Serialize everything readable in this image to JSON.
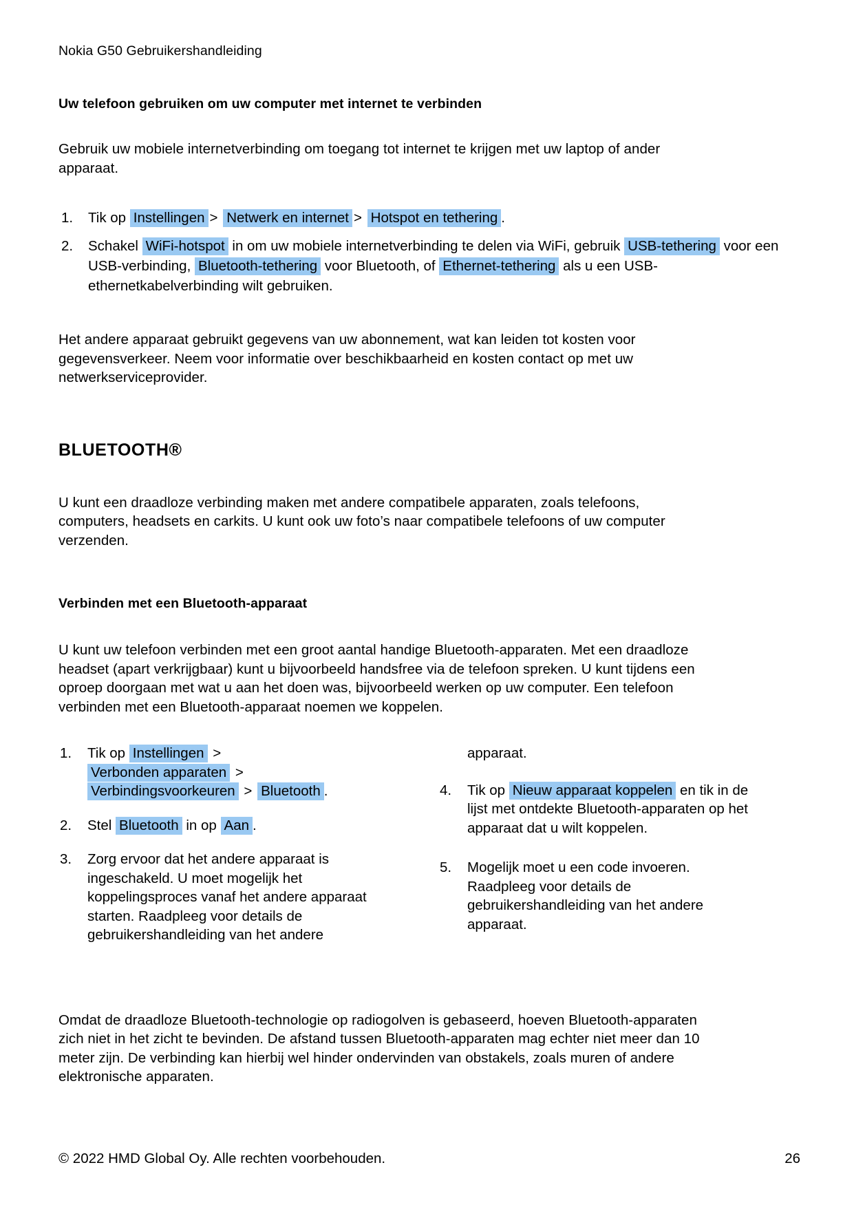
{
  "document": {
    "running_header": "Nokia G50 Gebruikershandleiding",
    "highlight_color": "#9AC9F2",
    "page_number": "26",
    "footer_copyright": "© 2022 HMD Global Oy. Alle rechten voorbehouden."
  },
  "section_tethering": {
    "heading": "Uw telefoon gebruiken om uw computer met internet te verbinden",
    "intro": "Gebruik uw mobiele internetverbinding om toegang tot internet te krijgen met uw laptop of ander apparaat.",
    "steps": [
      {
        "number": "1.",
        "lead": "Tik op",
        "chip1": "Instellingen",
        "sep1": ">",
        "chip2": "Netwerk en internet",
        "sep2": ">",
        "chip3": "Hotspot en tethering",
        "tail": "."
      },
      {
        "number": "2.",
        "lead": "Schakel",
        "chip1": "WiFi-hotspot",
        "mid1": "in om uw mobiele internetverbinding te delen via WiFi, gebruik",
        "chip2": "USB-tethering",
        "mid2": "voor een USB-verbinding,",
        "chip3": "Bluetooth-tethering",
        "mid3": "voor Bluetooth, of",
        "chip4": "Ethernet-tethering",
        "tail": "als u een USB-ethernetkabelverbinding wilt gebruiken."
      }
    ],
    "note": "Het andere apparaat gebruikt gegevens van uw abonnement, wat kan leiden tot kosten voor gegevensverkeer. Neem voor informatie over beschikbaarheid en kosten contact op met uw netwerkserviceprovider."
  },
  "section_bluetooth": {
    "heading": "BLUETOOTH®",
    "intro": "U kunt een draadloze verbinding maken met andere compatibele apparaten, zoals telefoons, computers, headsets en carkits. U kunt ook uw foto’s naar compatibele telefoons of uw computer verzenden.",
    "subheading": "Verbinden met een Bluetooth-apparaat",
    "body": "U kunt uw telefoon verbinden met een groot aantal handige Bluetooth-apparaten. Met een draadloze headset (apart verkrijgbaar) kunt u bijvoorbeeld handsfree via de telefoon spreken. U kunt tijdens een oproep doorgaan met wat u aan het doen was, bijvoorbeeld werken op uw computer. Een telefoon verbinden met een Bluetooth-apparaat noemen we koppelen.",
    "steps_left": [
      {
        "number": "1.",
        "lead": "Tik op",
        "chip1": "Instellingen",
        "sep1": ">",
        "chip2": "Verbonden apparaten",
        "sep2": ">",
        "chip3": "Verbindingsvoorkeuren",
        "sep3": ">",
        "chip4": "Bluetooth",
        "tail": "."
      },
      {
        "number": "2.",
        "lead": "Stel",
        "chip1": "Bluetooth",
        "mid1": "in op",
        "chip2": "Aan",
        "tail": "."
      },
      {
        "number": "3.",
        "text": "Zorg ervoor dat het andere apparaat is ingeschakeld. U moet mogelijk het koppelingsproces vanaf het andere apparaat starten. Raadpleeg voor details de gebruikershandleiding van het andere"
      }
    ],
    "steps_right_continuation": "apparaat.",
    "steps_right": [
      {
        "number": "4.",
        "lead": "Tik op",
        "chip1": "Nieuw apparaat koppelen",
        "tail": "en tik in de lijst met ontdekte Bluetooth-apparaten op het apparaat dat u wilt koppelen."
      },
      {
        "number": "5.",
        "text": "Mogelijk moet u een code invoeren. Raadpleeg voor details de gebruikershandleiding van het andere apparaat."
      }
    ],
    "closing": "Omdat de draadloze Bluetooth-technologie op radiogolven is gebaseerd, hoeven Bluetooth-apparaten zich niet in het zicht te bevinden. De afstand tussen Bluetooth-apparaten mag echter niet meer dan 10 meter zijn. De verbinding kan hierbij wel hinder ondervinden van obstakels, zoals muren of andere elektronische apparaten."
  }
}
